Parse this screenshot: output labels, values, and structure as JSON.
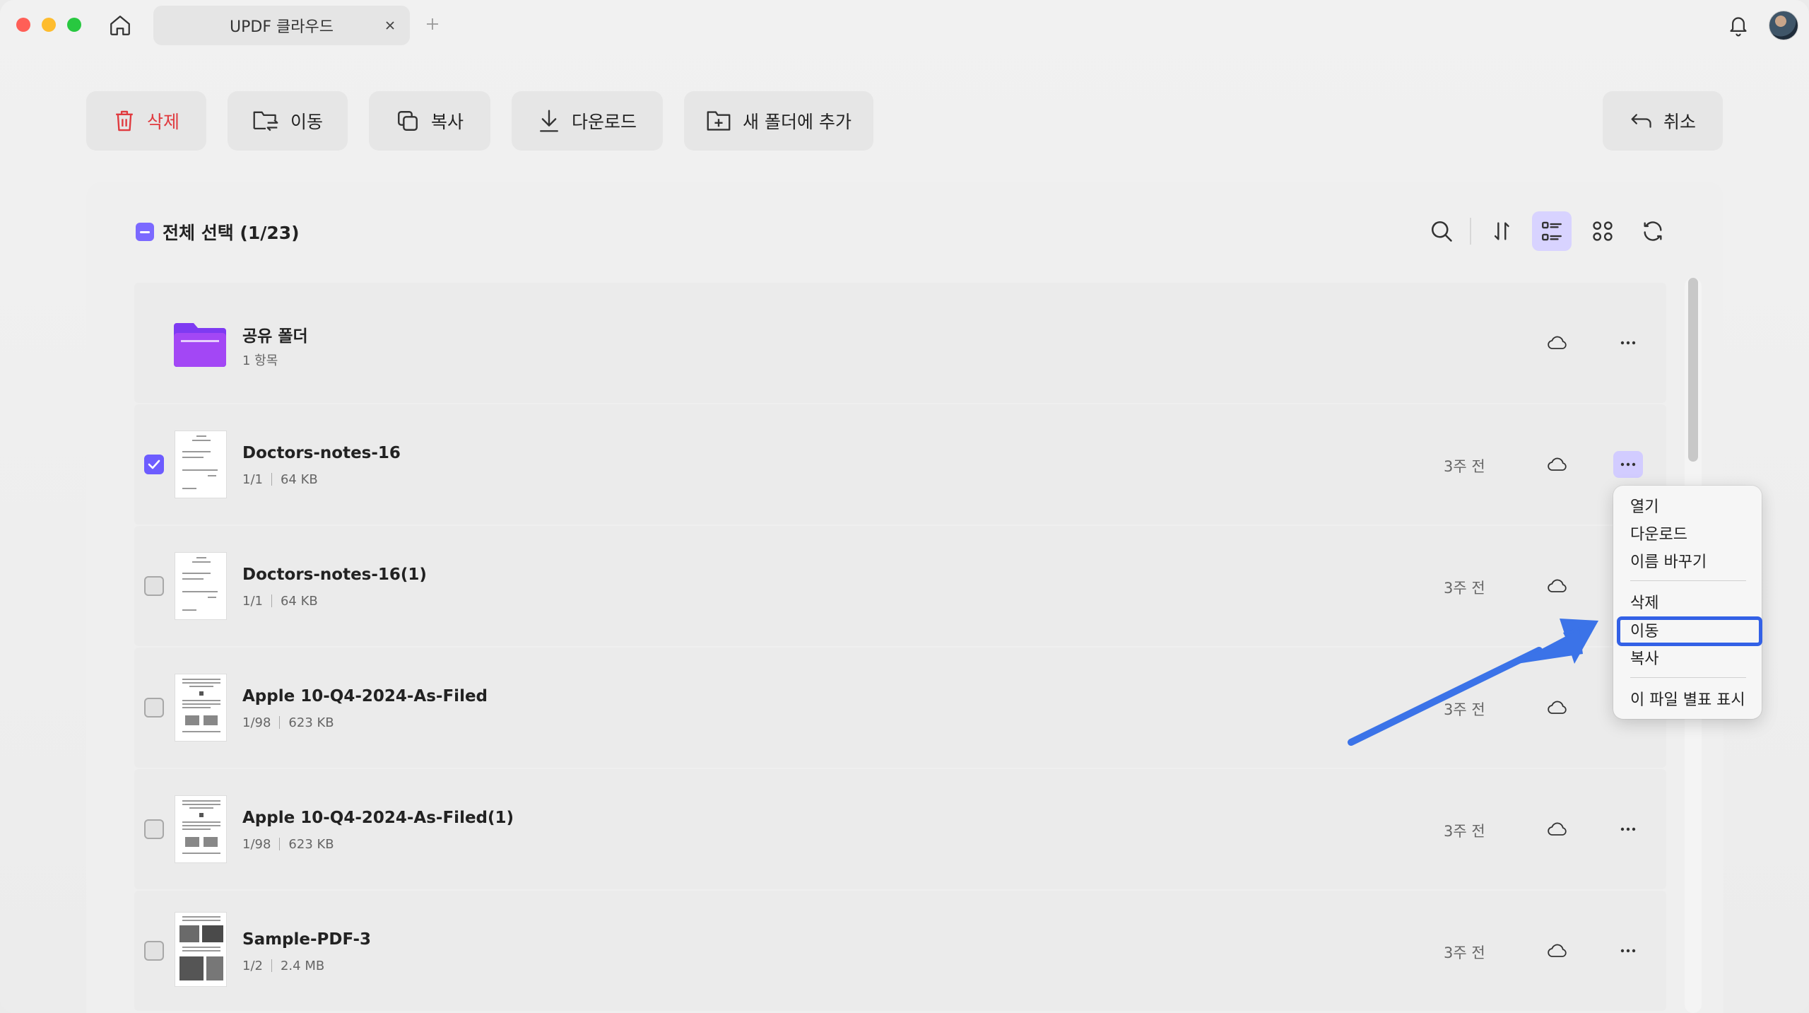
{
  "window": {
    "tab_title": "UPDF 클라우드"
  },
  "toolbar": {
    "delete_label": "삭제",
    "move_label": "이동",
    "copy_label": "복사",
    "download_label": "다운로드",
    "add_to_new_folder_label": "새 폴더에 추가",
    "cancel_label": "취소"
  },
  "list_header": {
    "select_all_label": "전체 선택 (1/23)"
  },
  "files": [
    {
      "name": "공유 폴더",
      "meta": "1 항목",
      "type": "folder",
      "checked": false,
      "date": ""
    },
    {
      "name": "Doctors-notes-16",
      "pages": "1/1",
      "size": "64 KB",
      "date": "3주 전",
      "type": "pdf",
      "checked": true
    },
    {
      "name": "Doctors-notes-16(1)",
      "pages": "1/1",
      "size": "64 KB",
      "date": "3주 전",
      "type": "pdf",
      "checked": false
    },
    {
      "name": "Apple 10-Q4-2024-As-Filed",
      "pages": "1/98",
      "size": "623 KB",
      "date": "3주 전",
      "type": "pdf",
      "checked": false
    },
    {
      "name": "Apple 10-Q4-2024-As-Filed(1)",
      "pages": "1/98",
      "size": "623 KB",
      "date": "3주 전",
      "type": "pdf",
      "checked": false
    },
    {
      "name": "Sample-PDF-3",
      "pages": "1/2",
      "size": "2.4 MB",
      "date": "3주 전",
      "type": "pdf",
      "checked": false
    }
  ],
  "context_menu": {
    "items": [
      "열기",
      "다운로드",
      "이름 바꾸기",
      "삭제",
      "이동",
      "복사",
      "이 파일 별표 표시"
    ],
    "highlighted": "이동"
  },
  "colors": {
    "accent": "#6d5cff",
    "danger": "#e0393e",
    "annotation": "#3b73e8"
  }
}
